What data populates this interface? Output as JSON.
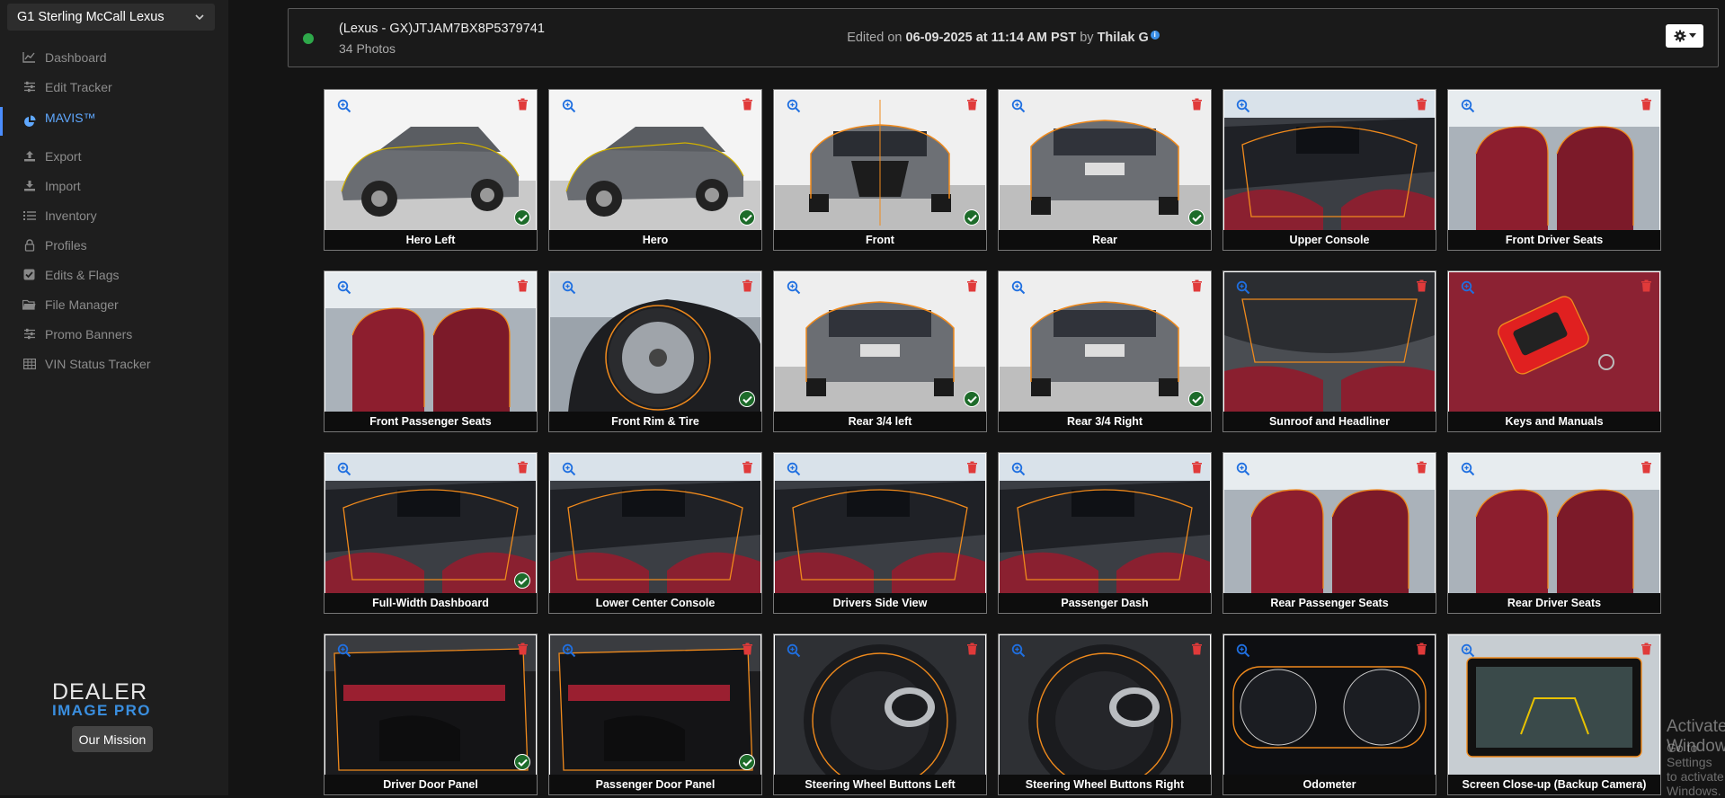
{
  "dealer": {
    "name": "G1 Sterling McCall Lexus"
  },
  "nav": [
    {
      "label": "Dashboard",
      "icon": "chart-line-icon"
    },
    {
      "label": "Edit Tracker",
      "icon": "sliders-icon"
    },
    {
      "label": "MAVIS™",
      "icon": "pie-chart-icon",
      "active": true
    },
    {
      "label": "Export",
      "icon": "upload-icon"
    },
    {
      "label": "Import",
      "icon": "download-icon"
    },
    {
      "label": "Inventory",
      "icon": "list-icon"
    },
    {
      "label": "Profiles",
      "icon": "lock-icon"
    },
    {
      "label": "Edits & Flags",
      "icon": "check-square-icon"
    },
    {
      "label": "File Manager",
      "icon": "folder-icon"
    },
    {
      "label": "Promo Banners",
      "icon": "sliders-icon"
    },
    {
      "label": "VIN Status Tracker",
      "icon": "table-icon"
    }
  ],
  "logo": {
    "line1": "DEALER",
    "line2": "IMAGE PRO"
  },
  "mission_button": "Our Mission",
  "vehicle": {
    "title": "(Lexus - GX)JTJAM7BX8P5379741",
    "photo_count": "34 Photos",
    "edited_prefix": "Edited on",
    "edited_date": "06-09-2025 at 11:14 AM PST",
    "edited_by_prefix": "by",
    "edited_by": "Thilak G"
  },
  "colors": {
    "status": "#2ea84a",
    "accent": "#4a8dff",
    "outline": "#f08a1c"
  },
  "photos": [
    {
      "label": "Hero Left",
      "checked": true,
      "scene": "car-left"
    },
    {
      "label": "Hero",
      "checked": true,
      "scene": "car-left"
    },
    {
      "label": "Front",
      "checked": true,
      "scene": "car-front"
    },
    {
      "label": "Rear",
      "checked": true,
      "scene": "car-rear"
    },
    {
      "label": "Upper Console",
      "checked": false,
      "scene": "interior"
    },
    {
      "label": "Front Driver Seats",
      "checked": false,
      "scene": "seats"
    },
    {
      "label": "Front Passenger Seats",
      "checked": false,
      "scene": "seats"
    },
    {
      "label": "Front Rim & Tire",
      "checked": true,
      "scene": "wheel"
    },
    {
      "label": "Rear 3/4 left",
      "checked": true,
      "scene": "car-rear"
    },
    {
      "label": "Rear 3/4 Right",
      "checked": true,
      "scene": "car-rear"
    },
    {
      "label": "Sunroof and Headliner",
      "checked": false,
      "scene": "headliner"
    },
    {
      "label": "Keys and Manuals",
      "checked": false,
      "scene": "keys"
    },
    {
      "label": "Full-Width Dashboard",
      "checked": true,
      "scene": "interior"
    },
    {
      "label": "Lower Center Console",
      "checked": false,
      "scene": "interior"
    },
    {
      "label": "Drivers Side View",
      "checked": false,
      "scene": "interior"
    },
    {
      "label": "Passenger Dash",
      "checked": false,
      "scene": "interior"
    },
    {
      "label": "Rear Passenger Seats",
      "checked": false,
      "scene": "seats"
    },
    {
      "label": "Rear Driver Seats",
      "checked": false,
      "scene": "seats"
    },
    {
      "label": "Driver Door Panel",
      "checked": true,
      "scene": "door"
    },
    {
      "label": "Passenger Door Panel",
      "checked": true,
      "scene": "door"
    },
    {
      "label": "Steering Wheel Buttons Left",
      "checked": false,
      "scene": "wheel-steer"
    },
    {
      "label": "Steering Wheel Buttons Right",
      "checked": false,
      "scene": "wheel-steer"
    },
    {
      "label": "Odometer",
      "checked": false,
      "scene": "gauge"
    },
    {
      "label": "Screen Close-up (Backup Camera)",
      "checked": false,
      "scene": "screen"
    }
  ],
  "watermark": {
    "title": "Activate Windows",
    "subtitle": "Go to Settings to activate Windows."
  }
}
